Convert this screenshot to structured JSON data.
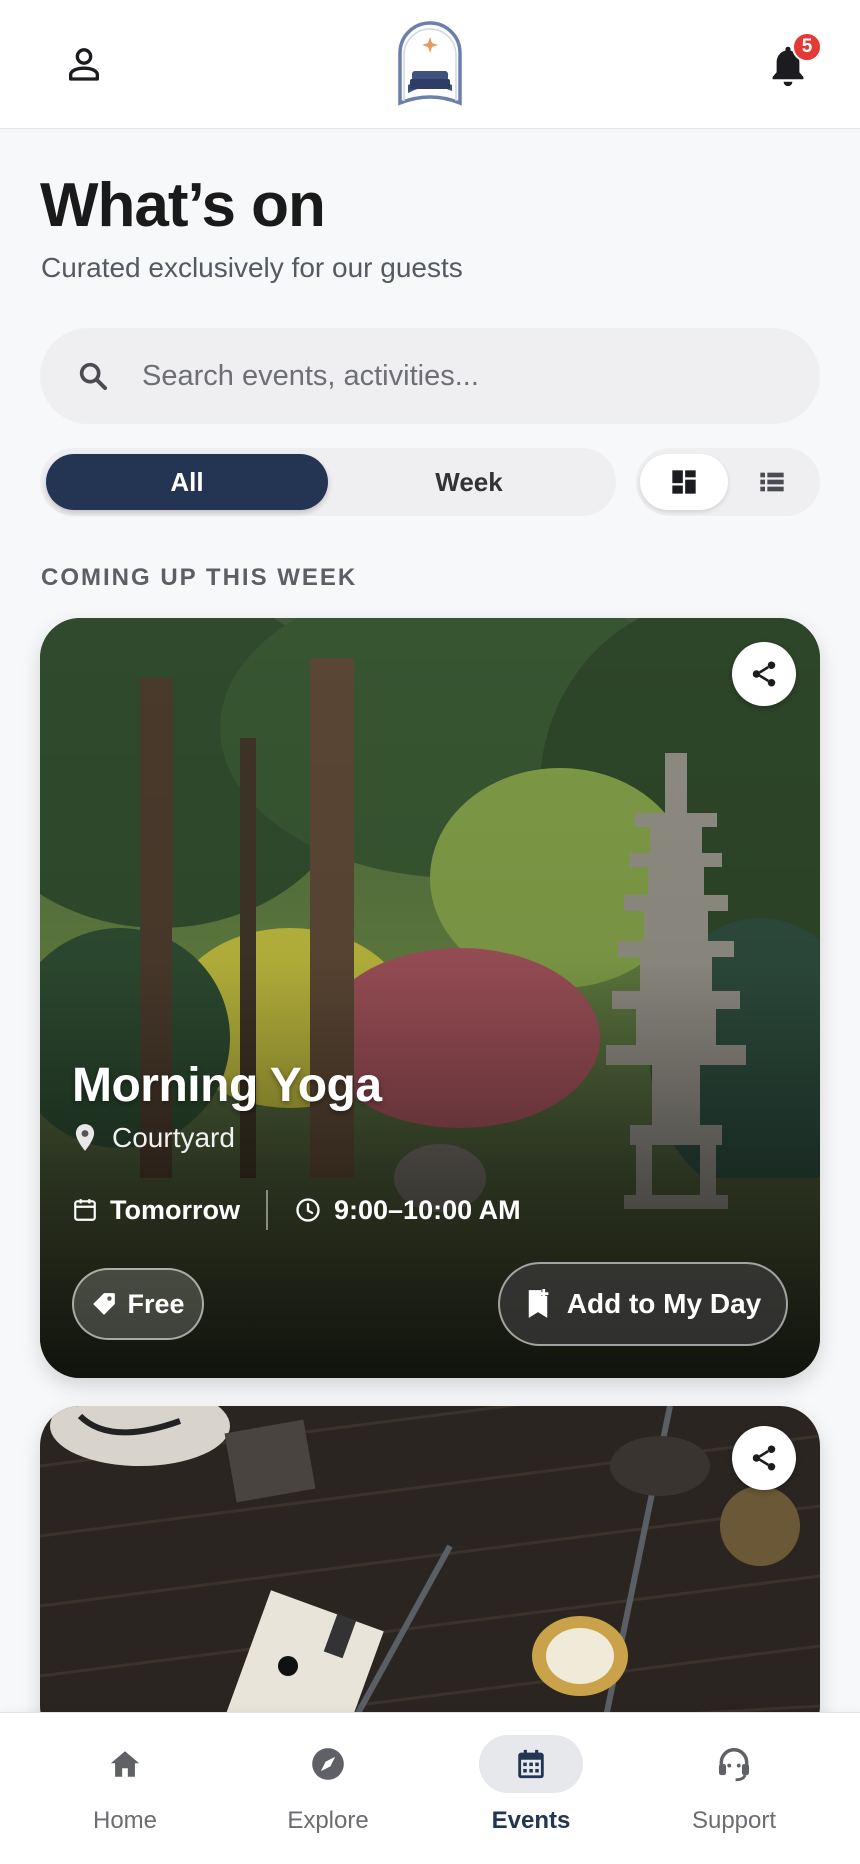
{
  "header": {
    "notifications_count": "5",
    "icons": [
      "person-icon",
      "hotel-logo",
      "bell-icon"
    ]
  },
  "page": {
    "title": "What’s on",
    "subtitle": "Curated exclusively for our guests"
  },
  "search": {
    "placeholder": "Search events, activities...",
    "value": ""
  },
  "filter": {
    "options": [
      "All",
      "Week"
    ],
    "selected": "All"
  },
  "view_toggle": {
    "options": [
      "grid",
      "list"
    ],
    "selected": "grid"
  },
  "section": {
    "label": "COMING UP THIS WEEK"
  },
  "events": [
    {
      "title": "Morning Yoga",
      "location": "Courtyard",
      "day": "Tomorrow",
      "time": "9:00–10:00 AM",
      "price": "Free",
      "action_label": "Add to My Day"
    }
  ],
  "nav": {
    "items": [
      {
        "label": "Home",
        "icon": "home-icon"
      },
      {
        "label": "Explore",
        "icon": "compass-icon"
      },
      {
        "label": "Events",
        "icon": "calendar-icon"
      },
      {
        "label": "Support",
        "icon": "headset-icon"
      }
    ],
    "active": "Events"
  },
  "colors": {
    "primary": "#233552",
    "badge": "#e53935",
    "background": "#f7f8fa",
    "logo_accent": "#e89a5c",
    "logo_blue": "#6b7fae"
  }
}
